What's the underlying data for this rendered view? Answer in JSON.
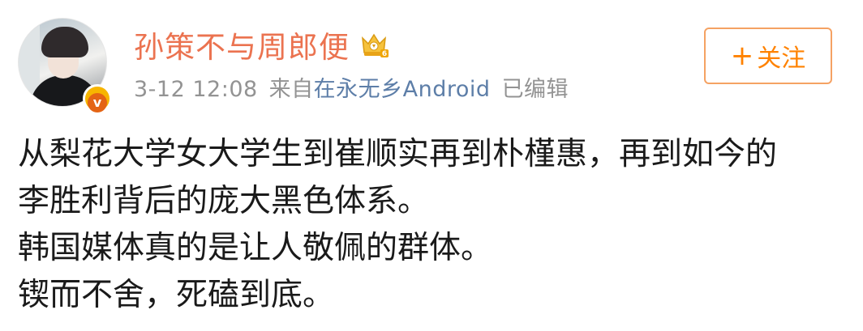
{
  "post": {
    "username": "孙策不与周郎便",
    "timestamp": "3-12 12:08",
    "source_prefix": "来自",
    "source_name": "在永无乡Android",
    "edited_label": "已编辑",
    "follow_button": {
      "plus": "+",
      "label": "关注"
    },
    "verify_badge_letter": "v",
    "icons": {
      "avatar": "user-avatar-photo",
      "verify": "verified-badge-icon",
      "vip": "vip-crown-icon"
    },
    "colors": {
      "username": "#eb7350",
      "meta": "#939393",
      "source_link": "#5d7ea8",
      "follow_border": "#f5a263",
      "follow_text": "#ff8200",
      "body_text": "#1a1a1a"
    },
    "content_lines": [
      "从梨花大学女大学生到崔顺实再到朴槿惠，再到如今的",
      "李胜利背后的庞大黑色体系。",
      "韩国媒体真的是让人敬佩的群体。",
      "锲而不舍，死磕到底。"
    ]
  }
}
